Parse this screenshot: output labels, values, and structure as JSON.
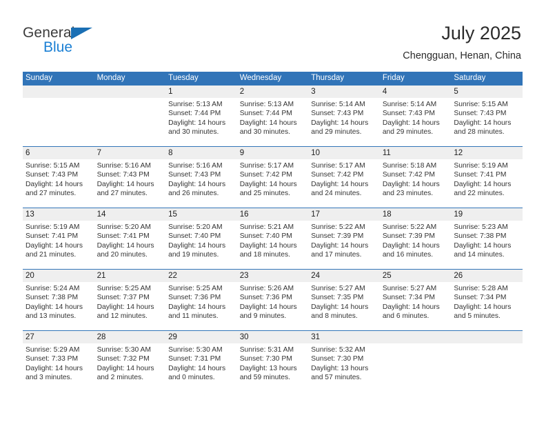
{
  "brand": {
    "name_part1": "General",
    "name_part2": "Blue",
    "triangle_icon": "triangle-flag-icon",
    "primary_color": "#1a7fd4"
  },
  "header": {
    "title": "July 2025",
    "subtitle": "Chengguan, Henan, China"
  },
  "theme": {
    "header_blue": "#3174b8",
    "row_gray": "#efefef",
    "text": "#333333"
  },
  "calendar": {
    "weekdays": [
      "Sunday",
      "Monday",
      "Tuesday",
      "Wednesday",
      "Thursday",
      "Friday",
      "Saturday"
    ],
    "weeks": [
      {
        "numbers": [
          "",
          "",
          "1",
          "2",
          "3",
          "4",
          "5"
        ],
        "details": [
          {
            "sunrise": "",
            "sunset": "",
            "daylight1": "",
            "daylight2": ""
          },
          {
            "sunrise": "",
            "sunset": "",
            "daylight1": "",
            "daylight2": ""
          },
          {
            "sunrise": "Sunrise: 5:13 AM",
            "sunset": "Sunset: 7:44 PM",
            "daylight1": "Daylight: 14 hours",
            "daylight2": "and 30 minutes."
          },
          {
            "sunrise": "Sunrise: 5:13 AM",
            "sunset": "Sunset: 7:44 PM",
            "daylight1": "Daylight: 14 hours",
            "daylight2": "and 30 minutes."
          },
          {
            "sunrise": "Sunrise: 5:14 AM",
            "sunset": "Sunset: 7:43 PM",
            "daylight1": "Daylight: 14 hours",
            "daylight2": "and 29 minutes."
          },
          {
            "sunrise": "Sunrise: 5:14 AM",
            "sunset": "Sunset: 7:43 PM",
            "daylight1": "Daylight: 14 hours",
            "daylight2": "and 29 minutes."
          },
          {
            "sunrise": "Sunrise: 5:15 AM",
            "sunset": "Sunset: 7:43 PM",
            "daylight1": "Daylight: 14 hours",
            "daylight2": "and 28 minutes."
          }
        ]
      },
      {
        "numbers": [
          "6",
          "7",
          "8",
          "9",
          "10",
          "11",
          "12"
        ],
        "details": [
          {
            "sunrise": "Sunrise: 5:15 AM",
            "sunset": "Sunset: 7:43 PM",
            "daylight1": "Daylight: 14 hours",
            "daylight2": "and 27 minutes."
          },
          {
            "sunrise": "Sunrise: 5:16 AM",
            "sunset": "Sunset: 7:43 PM",
            "daylight1": "Daylight: 14 hours",
            "daylight2": "and 27 minutes."
          },
          {
            "sunrise": "Sunrise: 5:16 AM",
            "sunset": "Sunset: 7:43 PM",
            "daylight1": "Daylight: 14 hours",
            "daylight2": "and 26 minutes."
          },
          {
            "sunrise": "Sunrise: 5:17 AM",
            "sunset": "Sunset: 7:42 PM",
            "daylight1": "Daylight: 14 hours",
            "daylight2": "and 25 minutes."
          },
          {
            "sunrise": "Sunrise: 5:17 AM",
            "sunset": "Sunset: 7:42 PM",
            "daylight1": "Daylight: 14 hours",
            "daylight2": "and 24 minutes."
          },
          {
            "sunrise": "Sunrise: 5:18 AM",
            "sunset": "Sunset: 7:42 PM",
            "daylight1": "Daylight: 14 hours",
            "daylight2": "and 23 minutes."
          },
          {
            "sunrise": "Sunrise: 5:19 AM",
            "sunset": "Sunset: 7:41 PM",
            "daylight1": "Daylight: 14 hours",
            "daylight2": "and 22 minutes."
          }
        ]
      },
      {
        "numbers": [
          "13",
          "14",
          "15",
          "16",
          "17",
          "18",
          "19"
        ],
        "details": [
          {
            "sunrise": "Sunrise: 5:19 AM",
            "sunset": "Sunset: 7:41 PM",
            "daylight1": "Daylight: 14 hours",
            "daylight2": "and 21 minutes."
          },
          {
            "sunrise": "Sunrise: 5:20 AM",
            "sunset": "Sunset: 7:41 PM",
            "daylight1": "Daylight: 14 hours",
            "daylight2": "and 20 minutes."
          },
          {
            "sunrise": "Sunrise: 5:20 AM",
            "sunset": "Sunset: 7:40 PM",
            "daylight1": "Daylight: 14 hours",
            "daylight2": "and 19 minutes."
          },
          {
            "sunrise": "Sunrise: 5:21 AM",
            "sunset": "Sunset: 7:40 PM",
            "daylight1": "Daylight: 14 hours",
            "daylight2": "and 18 minutes."
          },
          {
            "sunrise": "Sunrise: 5:22 AM",
            "sunset": "Sunset: 7:39 PM",
            "daylight1": "Daylight: 14 hours",
            "daylight2": "and 17 minutes."
          },
          {
            "sunrise": "Sunrise: 5:22 AM",
            "sunset": "Sunset: 7:39 PM",
            "daylight1": "Daylight: 14 hours",
            "daylight2": "and 16 minutes."
          },
          {
            "sunrise": "Sunrise: 5:23 AM",
            "sunset": "Sunset: 7:38 PM",
            "daylight1": "Daylight: 14 hours",
            "daylight2": "and 14 minutes."
          }
        ]
      },
      {
        "numbers": [
          "20",
          "21",
          "22",
          "23",
          "24",
          "25",
          "26"
        ],
        "details": [
          {
            "sunrise": "Sunrise: 5:24 AM",
            "sunset": "Sunset: 7:38 PM",
            "daylight1": "Daylight: 14 hours",
            "daylight2": "and 13 minutes."
          },
          {
            "sunrise": "Sunrise: 5:25 AM",
            "sunset": "Sunset: 7:37 PM",
            "daylight1": "Daylight: 14 hours",
            "daylight2": "and 12 minutes."
          },
          {
            "sunrise": "Sunrise: 5:25 AM",
            "sunset": "Sunset: 7:36 PM",
            "daylight1": "Daylight: 14 hours",
            "daylight2": "and 11 minutes."
          },
          {
            "sunrise": "Sunrise: 5:26 AM",
            "sunset": "Sunset: 7:36 PM",
            "daylight1": "Daylight: 14 hours",
            "daylight2": "and 9 minutes."
          },
          {
            "sunrise": "Sunrise: 5:27 AM",
            "sunset": "Sunset: 7:35 PM",
            "daylight1": "Daylight: 14 hours",
            "daylight2": "and 8 minutes."
          },
          {
            "sunrise": "Sunrise: 5:27 AM",
            "sunset": "Sunset: 7:34 PM",
            "daylight1": "Daylight: 14 hours",
            "daylight2": "and 6 minutes."
          },
          {
            "sunrise": "Sunrise: 5:28 AM",
            "sunset": "Sunset: 7:34 PM",
            "daylight1": "Daylight: 14 hours",
            "daylight2": "and 5 minutes."
          }
        ]
      },
      {
        "numbers": [
          "27",
          "28",
          "29",
          "30",
          "31",
          "",
          ""
        ],
        "details": [
          {
            "sunrise": "Sunrise: 5:29 AM",
            "sunset": "Sunset: 7:33 PM",
            "daylight1": "Daylight: 14 hours",
            "daylight2": "and 3 minutes."
          },
          {
            "sunrise": "Sunrise: 5:30 AM",
            "sunset": "Sunset: 7:32 PM",
            "daylight1": "Daylight: 14 hours",
            "daylight2": "and 2 minutes."
          },
          {
            "sunrise": "Sunrise: 5:30 AM",
            "sunset": "Sunset: 7:31 PM",
            "daylight1": "Daylight: 14 hours",
            "daylight2": "and 0 minutes."
          },
          {
            "sunrise": "Sunrise: 5:31 AM",
            "sunset": "Sunset: 7:30 PM",
            "daylight1": "Daylight: 13 hours",
            "daylight2": "and 59 minutes."
          },
          {
            "sunrise": "Sunrise: 5:32 AM",
            "sunset": "Sunset: 7:30 PM",
            "daylight1": "Daylight: 13 hours",
            "daylight2": "and 57 minutes."
          },
          {
            "sunrise": "",
            "sunset": "",
            "daylight1": "",
            "daylight2": ""
          },
          {
            "sunrise": "",
            "sunset": "",
            "daylight1": "",
            "daylight2": ""
          }
        ]
      }
    ]
  }
}
